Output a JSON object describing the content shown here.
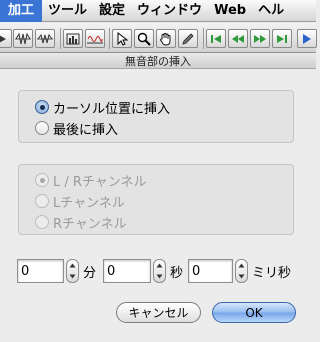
{
  "menubar": {
    "items": [
      {
        "label": "加工",
        "active": true
      },
      {
        "label": "ツール",
        "active": false
      },
      {
        "label": "設定",
        "active": false
      },
      {
        "label": "ウィンドウ",
        "active": false
      },
      {
        "label": "Web",
        "active": false
      },
      {
        "label": "ヘル",
        "active": false
      }
    ]
  },
  "toolbar": {
    "tools": [
      "play-partial-icon",
      "waveform-a-icon",
      "waveform-b-icon",
      "spectrum-icon",
      "waveform-zoom-icon",
      "pointer-icon",
      "magnifier-icon",
      "hand-icon",
      "pencil-icon",
      "skip-to-start-icon",
      "rewind-icon",
      "fast-forward-icon",
      "skip-to-end-icon",
      "play-icon"
    ]
  },
  "dialog": {
    "title": "無音部の挿入",
    "position_group": {
      "options": [
        {
          "label": "カーソル位置に挿入",
          "selected": true
        },
        {
          "label": "最後に挿入",
          "selected": false
        }
      ]
    },
    "channel_group": {
      "enabled": false,
      "options": [
        {
          "label": "L / Rチャンネル",
          "selected": true
        },
        {
          "label": "Lチャンネル",
          "selected": false
        },
        {
          "label": "Rチャンネル",
          "selected": false
        }
      ]
    },
    "duration": {
      "minutes": {
        "value": "0",
        "unit": "分"
      },
      "seconds": {
        "value": "0",
        "unit": "秒"
      },
      "milliseconds": {
        "value": "0",
        "unit": "ミリ秒"
      }
    },
    "buttons": {
      "cancel": "キャンセル",
      "ok": "OK"
    }
  },
  "colors": {
    "menu_highlight": "#3a75d6",
    "transport_green": "#2e9a3a",
    "play_blue": "#2b63c8"
  }
}
